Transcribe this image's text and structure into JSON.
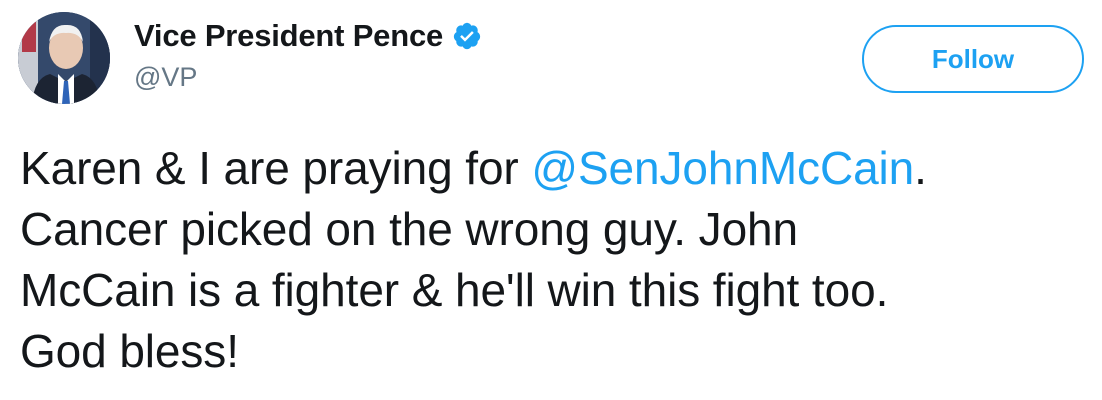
{
  "author": {
    "display_name": "Vice President Pence",
    "handle": "@VP",
    "verified": true,
    "avatar_icon": "profile-photo"
  },
  "actions": {
    "follow_label": "Follow"
  },
  "tweet": {
    "line1_pre": "Karen & I are praying for ",
    "line1_mention": "@SenJohnMcCain",
    "line1_post": ".",
    "line2": "Cancer picked on the wrong guy. John",
    "line3": "McCain is a fighter & he'll win this fight too.",
    "line4": "God bless!"
  },
  "colors": {
    "accent": "#1da1f2",
    "text": "#14171a",
    "secondary_text": "#657786"
  }
}
